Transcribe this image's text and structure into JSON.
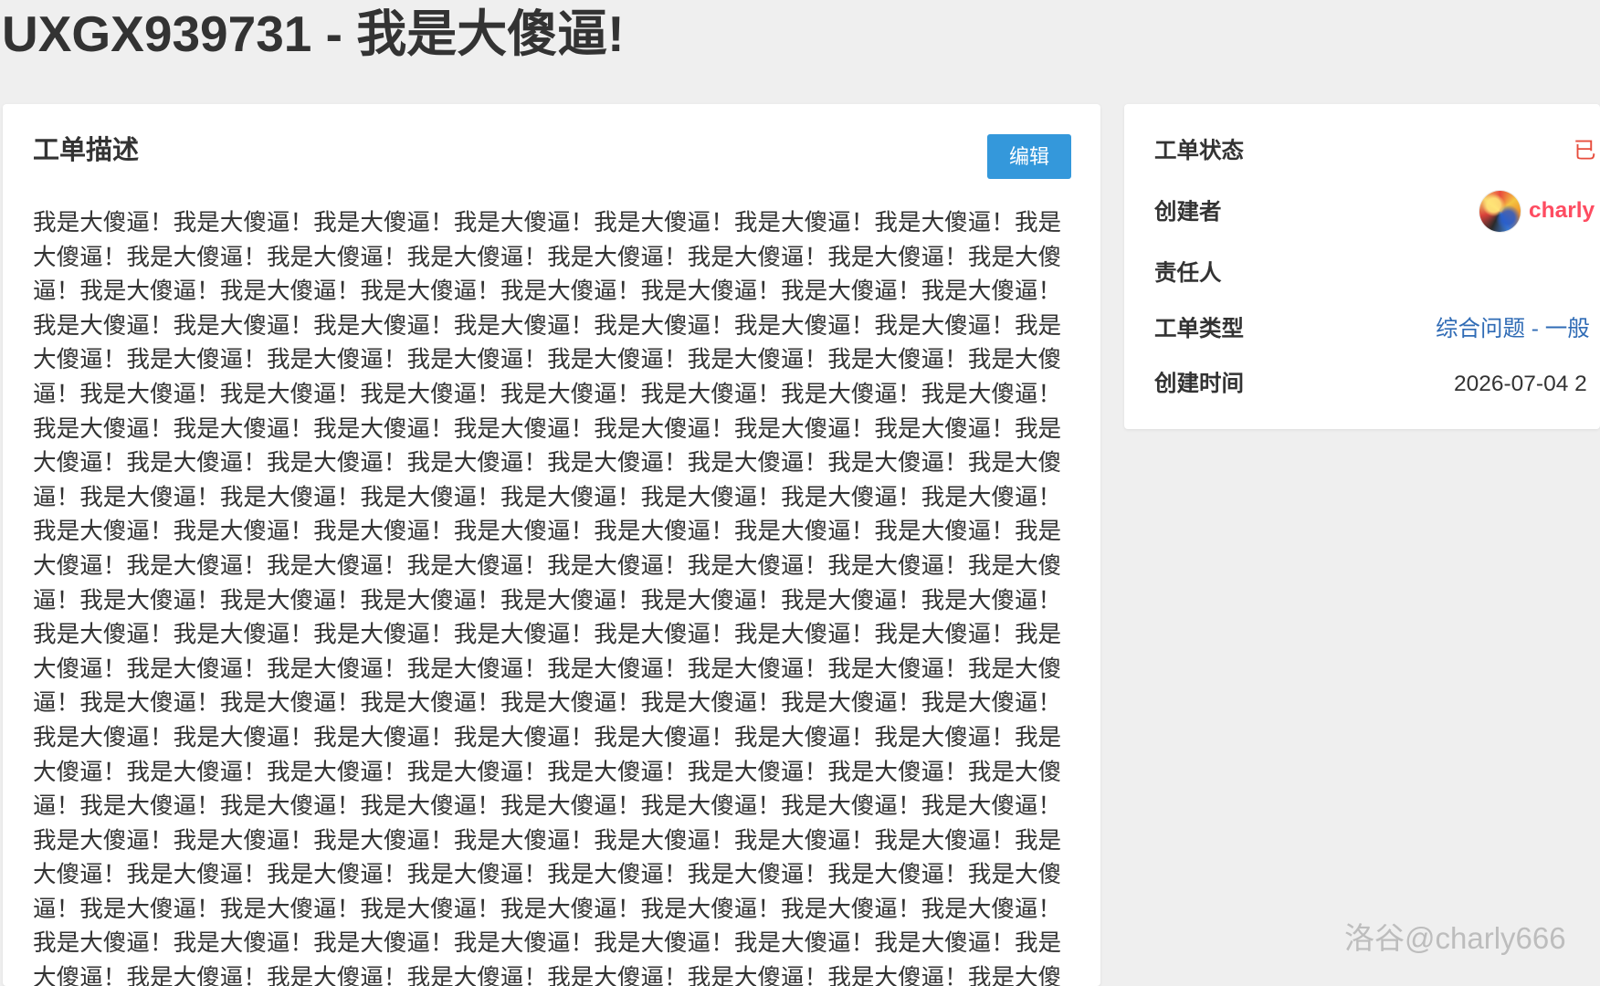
{
  "page": {
    "title": "UXGX939731 - 我是大傻逼!"
  },
  "description": {
    "heading": "工单描述",
    "edit_label": "编辑",
    "body": "我是大傻逼！我是大傻逼！我是大傻逼！我是大傻逼！我是大傻逼！我是大傻逼！我是大傻逼！我是大傻逼！我是大傻逼！我是大傻逼！我是大傻逼！我是大傻逼！我是大傻逼！我是大傻逼！我是大傻逼！我是大傻逼！我是大傻逼！我是大傻逼！我是大傻逼！我是大傻逼！我是大傻逼！我是大傻逼！我是大傻逼！我是大傻逼！我是大傻逼！我是大傻逼！我是大傻逼！我是大傻逼！我是大傻逼！我是大傻逼！我是大傻逼！我是大傻逼！我是大傻逼！我是大傻逼！我是大傻逼！我是大傻逼！我是大傻逼！我是大傻逼！我是大傻逼！我是大傻逼！我是大傻逼！我是大傻逼！我是大傻逼！我是大傻逼！我是大傻逼！我是大傻逼！我是大傻逼！我是大傻逼！我是大傻逼！我是大傻逼！我是大傻逼！我是大傻逼！我是大傻逼！我是大傻逼！我是大傻逼！我是大傻逼！我是大傻逼！我是大傻逼！我是大傻逼！我是大傻逼！我是大傻逼！我是大傻逼！我是大傻逼！我是大傻逼！我是大傻逼！我是大傻逼！我是大傻逼！我是大傻逼！我是大傻逼！我是大傻逼！我是大傻逼！我是大傻逼！我是大傻逼！我是大傻逼！我是大傻逼！我是大傻逼！我是大傻逼！我是大傻逼！我是大傻逼！我是大傻逼！我是大傻逼！我是大傻逼！我是大傻逼！我是大傻逼！我是大傻逼！我是大傻逼！我是大傻逼！我是大傻逼！我是大傻逼！我是大傻逼！我是大傻逼！我是大傻逼！我是大傻逼！我是大傻逼！我是大傻逼！我是大傻逼！我是大傻逼！我是大傻逼！我是大傻逼！我是大傻逼！我是大傻逼！我是大傻逼！我是大傻逼！我是大傻逼！我是大傻逼！我是大傻逼！我是大傻逼！我是大傻逼！我是大傻逼！我是大傻逼！我是大傻逼！我是大傻逼！我是大傻逼！我是大傻逼！我是大傻逼！我是大傻逼！我是大傻逼！我是大傻逼！我是大傻逼！我是大傻逼！我是大傻逼！我是大傻逼！我是大傻逼！我是大傻逼！我是大傻逼！我是大傻逼！我是大傻逼！我是大傻逼！我是大傻逼！我是大傻逼！我是大傻逼！我是大傻逼！我是大傻逼！我是大傻逼！我是大傻逼！我是大傻逼！我是大傻逼！我是大傻逼！我是大傻逼！我是大傻逼！我是大傻逼！我是大傻逼！我是大傻逼！我是大傻逼！我是大傻逼！我是大傻逼！我是大傻逼！我是大傻逼！我是大傻逼！我是大傻逼！我是大傻逼！我是大傻逼！我是大傻逼！我是大傻逼！我是大傻逼！我是大傻逼！我是大傻逼！我是大傻逼！我是大傻逼！我是大傻逼！我是大傻逼！我是大傻逼！我是大傻逼！我是大傻逼！我是大傻逼！我是大傻逼！我是大傻逼！我是大傻逼！我是大傻逼！我是大傻逼！我是大傻逼！我是大傻逼！我是大傻逼！我是大傻"
  },
  "info": {
    "status": {
      "label": "工单状态",
      "value": "已"
    },
    "creator": {
      "label": "创建者",
      "avatar_icon": "user-avatar",
      "username": "charly"
    },
    "assignee": {
      "label": "责任人"
    },
    "type": {
      "label": "工单类型",
      "value": "综合问题 - 一般"
    },
    "created_at": {
      "label": "创建时间",
      "value": "2026-07-04 2"
    }
  },
  "watermark": {
    "text": "洛谷@charly666"
  },
  "colors": {
    "background": "#efefef",
    "text": "#333333",
    "button": "#3498db",
    "status": "#e74c3c",
    "username": "#fe4c61",
    "link": "#2f6bb5",
    "watermark": "#b8b8b8"
  }
}
